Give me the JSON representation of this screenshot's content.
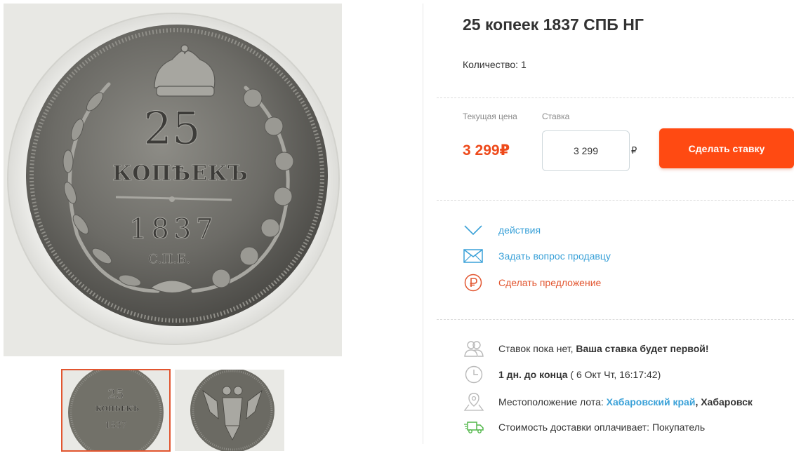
{
  "lot": {
    "title": "25 копеек 1837 СПБ НГ",
    "quantity": "Количество: 1"
  },
  "gallery": {
    "main_alt": "coin reverse: 25 КОПѢЕКЪ 1837 С.П.Б.",
    "coin_value": "25",
    "coin_word": "КОПѢЕКЪ",
    "coin_year": "1837",
    "coin_mint": "С.П.Б.",
    "thumb_labels": [
      "25 КОПѢЕКЪ 1837",
      "орёл"
    ]
  },
  "bidding": {
    "current_price_label": "Текущая цена",
    "bid_label": "Ставка",
    "current_price": "3 299₽",
    "bid_value": "3 299",
    "bid_currency": "₽",
    "bid_button": "Сделать ставку"
  },
  "actions": [
    {
      "label": "действия",
      "icon": "chevron-down-icon",
      "color": "#3aa1d8"
    },
    {
      "label": "Задать вопрос продавцу",
      "icon": "envelope-icon",
      "color": "#3aa1d8"
    },
    {
      "label": "Сделать предложение",
      "icon": "ruble-circle-icon",
      "color": "#e2552f"
    }
  ],
  "info": {
    "bids_text": "Ставок пока нет, ",
    "bids_bold": "Ваша ставка будет первой!",
    "time_bold": "1 дн. до конца",
    "time_rest": " ( 6 Окт Чт, 16:17:42)",
    "location_label": "Местоположение лота: ",
    "location_region": "Хабаровский край",
    "location_city": ", Хабаровск",
    "shipping": "Стоимость доставки оплачивает: Покупатель"
  },
  "colors": {
    "accent": "#ff4a12",
    "price": "#ee4a1b",
    "link": "#3aa1d8",
    "shipping": "#52b74a"
  }
}
